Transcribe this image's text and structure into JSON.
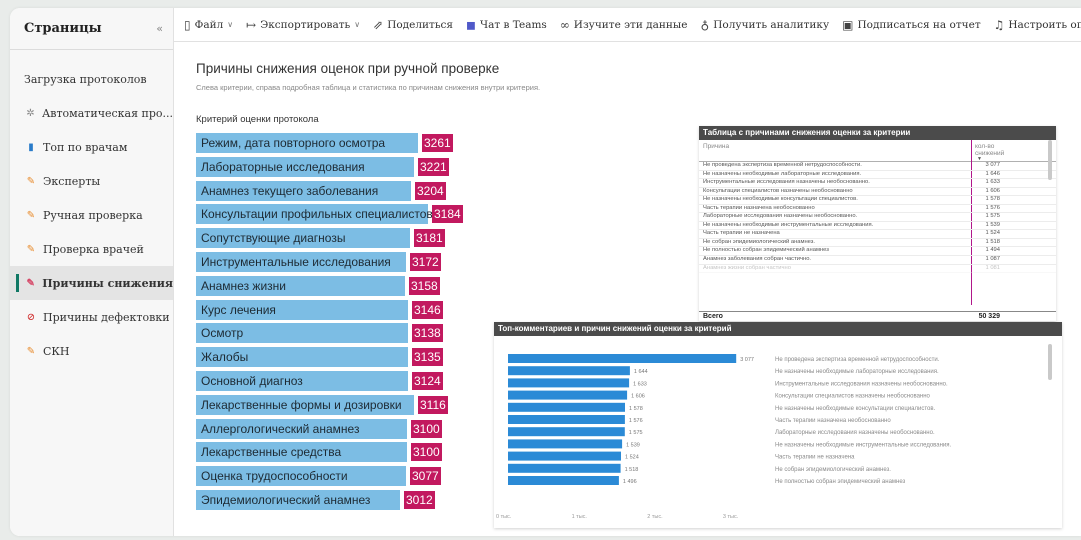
{
  "sidebar": {
    "title": "Страницы",
    "collapse_icon": "«",
    "items": [
      {
        "label": "Загрузка протоколов",
        "icon": "",
        "active": false
      },
      {
        "label": "Автоматическая про...",
        "icon": "gear-icon",
        "active": false
      },
      {
        "label": "Топ по врачам",
        "icon": "bar-chart-icon",
        "active": false
      },
      {
        "label": "Эксперты",
        "icon": "pencil-icon",
        "active": false
      },
      {
        "label": "Ручная проверка",
        "icon": "pencil-icon",
        "active": false
      },
      {
        "label": "Проверка врачей",
        "icon": "pencil-icon",
        "active": false
      },
      {
        "label": "Причины снижения",
        "icon": "pencil-icon",
        "active": true
      },
      {
        "label": "Причины дефектовки",
        "icon": "ban-icon",
        "active": false
      },
      {
        "label": "СКН",
        "icon": "pencil-icon",
        "active": false
      }
    ]
  },
  "toolbar": {
    "file": "Файл",
    "export": "Экспортировать",
    "share": "Поделиться",
    "teams": "Чат в Teams",
    "explore": "Изучите эти данные",
    "insights": "Получить аналитику",
    "subscribe": "Подписаться на отчет",
    "alerts": "Настроить оповещения"
  },
  "report": {
    "title": "Причины снижения оценок при ручной проверке",
    "subtitle": "Слева критерии, справа подробная таблица и статистика по причинам снижения внутри критерия.",
    "criteria_header": "Критерий оценки протокола",
    "criteria": [
      {
        "label": "Режим, дата повторного осмотра",
        "value": "3261"
      },
      {
        "label": "Лабораторные исследования",
        "value": "3221"
      },
      {
        "label": "Анамнез текущего заболевания",
        "value": "3204"
      },
      {
        "label": "Консультации профильных специалистов",
        "value": "3184"
      },
      {
        "label": "Сопутствующие диагнозы",
        "value": "3181"
      },
      {
        "label": "Инструментальные исследования",
        "value": "3172"
      },
      {
        "label": "Анамнез жизни",
        "value": "3158"
      },
      {
        "label": "Курс лечения",
        "value": "3146"
      },
      {
        "label": "Осмотр",
        "value": "3138"
      },
      {
        "label": "Жалобы",
        "value": "3135"
      },
      {
        "label": "Основной диагноз",
        "value": "3124"
      },
      {
        "label": "Лекарственные формы и дозировки",
        "value": "3116"
      },
      {
        "label": "Аллергологический анамнез",
        "value": "3100"
      },
      {
        "label": "Лекарственные средства",
        "value": "3100"
      },
      {
        "label": "Оценка трудоспособности",
        "value": "3077"
      },
      {
        "label": "Эпидемиологический анамнез",
        "value": "3012"
      }
    ]
  },
  "table": {
    "title": "Таблица с причинами снижения оценки за критерии",
    "col_reason": "Причина",
    "col_count_line1": "кол-во",
    "col_count_line2": "снижений",
    "rows": [
      {
        "reason": "Не проведена экспертиза временной нетрудоспособности.",
        "count": "3 077"
      },
      {
        "reason": "Не назначены необходимые лабораторные исследования.",
        "count": "1 646"
      },
      {
        "reason": "Инструментальные исследования назначены необоснованно.",
        "count": "1 633"
      },
      {
        "reason": "Консультации специалистов назначены необоснованно",
        "count": "1 606"
      },
      {
        "reason": "Не назначены необходимые консультации специалистов.",
        "count": "1 578"
      },
      {
        "reason": "Часть терапии назначена необоснованно",
        "count": "1 576"
      },
      {
        "reason": "Лабораторные исследования назначены необоснованно.",
        "count": "1 575"
      },
      {
        "reason": "Не назначены необходимые инструментальные исследования.",
        "count": "1 539"
      },
      {
        "reason": "Часть терапии не назначена",
        "count": "1 524"
      },
      {
        "reason": "Не собран эпидемиологический анамнез.",
        "count": "1 518"
      },
      {
        "reason": "Не полностью собран эпидемический анамнез",
        "count": "1 494"
      },
      {
        "reason": "Анамнез заболевания собран частично.",
        "count": "1 087"
      },
      {
        "reason": "Анамнез жизни собран частично",
        "count": "1 081"
      }
    ],
    "total_label": "Всего",
    "total_value": "50 329"
  },
  "chart_data": {
    "type": "bar",
    "title": "Топ-комментариев и причин снижений оценки за критерий",
    "orientation": "horizontal",
    "categories": [
      "Не проведена экспертиза временной нетрудоспособности.",
      "Не назначены необходимые лабораторные исследования.",
      "Инструментальные исследования назначены необоснованно.",
      "Консультации специалистов назначены необоснованно",
      "Не назначены необходимые консультации специалистов.",
      "Часть терапии назначена необоснованно",
      "Лабораторные исследования назначены необоснованно.",
      "Не назначены необходимые инструментальные исследования.",
      "Часть терапии не назначена",
      "Не собран эпидемиологический анамнез.",
      "Не полностью собран эпидемический анамнез"
    ],
    "values": [
      3077,
      1644,
      1633,
      1606,
      1578,
      1576,
      1575,
      1539,
      1524,
      1518,
      1496
    ],
    "value_labels": [
      "3 077",
      "1 644",
      "1 633",
      "1 606",
      "1 578",
      "1 576",
      "1 575",
      "1 539",
      "1 524",
      "1 518",
      "1 496"
    ],
    "x_ticks": [
      {
        "value": 0,
        "label": "0 тыс."
      },
      {
        "value": 1000,
        "label": "1 тыс."
      },
      {
        "value": 2000,
        "label": "2 тыс."
      },
      {
        "value": 3000,
        "label": "3 тыс."
      }
    ],
    "xlim": [
      0,
      3300
    ],
    "bar_color": "#2b8ad6",
    "grid": false
  },
  "colors": {
    "criteria_bar": "#7cbde4",
    "criteria_value_badge": "#c2195f",
    "accent": "#117865"
  }
}
